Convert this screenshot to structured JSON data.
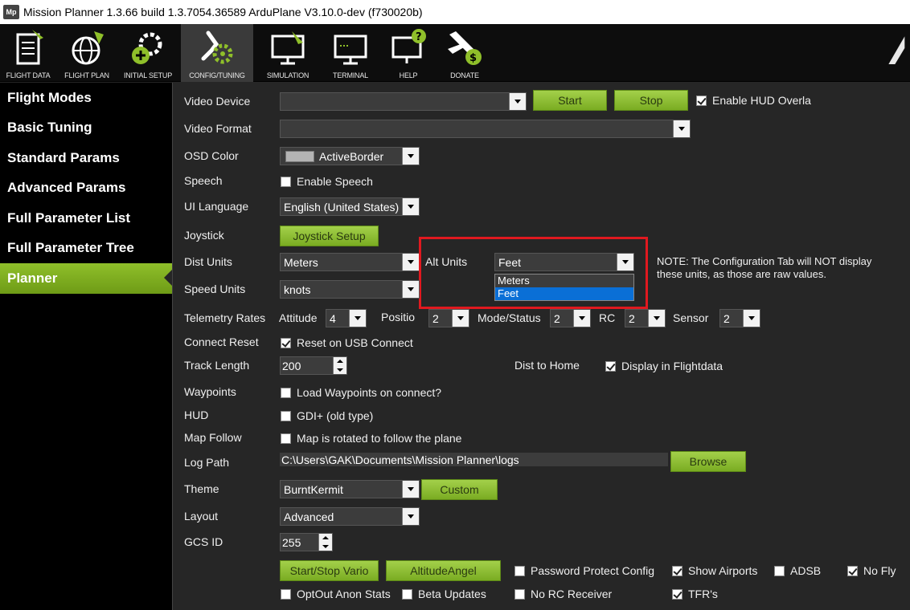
{
  "window": {
    "title": "Mission Planner 1.3.66 build 1.3.7054.36589 ArduPlane V3.10.0-dev (f730020b)",
    "icon_text": "Mp"
  },
  "toolbar": {
    "buttons": [
      {
        "label": "FLIGHT DATA",
        "icon": "flight-data-icon"
      },
      {
        "label": "FLIGHT PLAN",
        "icon": "flight-plan-icon"
      },
      {
        "label": "INITIAL SETUP",
        "icon": "initial-setup-icon"
      },
      {
        "label": "CONFIG/TUNING",
        "icon": "config-tuning-icon"
      },
      {
        "label": "SIMULATION",
        "icon": "simulation-icon"
      },
      {
        "label": "TERMINAL",
        "icon": "terminal-icon"
      },
      {
        "label": "HELP",
        "icon": "help-icon"
      },
      {
        "label": "DONATE",
        "icon": "donate-icon"
      }
    ],
    "active": "CONFIG/TUNING"
  },
  "sidebar": {
    "items": [
      {
        "label": "Flight Modes"
      },
      {
        "label": "Basic Tuning"
      },
      {
        "label": "Standard Params"
      },
      {
        "label": "Advanced Params"
      },
      {
        "label": "Full Parameter List"
      },
      {
        "label": "Full Parameter Tree"
      },
      {
        "label": "Planner"
      }
    ],
    "active": "Planner"
  },
  "planner": {
    "video_device": {
      "label": "Video Device",
      "value": "",
      "start": "Start",
      "stop": "Stop",
      "hud_overlay": "Enable HUD Overla",
      "hud_checked": true
    },
    "video_format": {
      "label": "Video Format",
      "value": ""
    },
    "osd_color": {
      "label": "OSD Color",
      "value": "ActiveBorder"
    },
    "speech": {
      "label": "Speech",
      "checkbox": "Enable Speech",
      "checked": false
    },
    "ui_language": {
      "label": "UI Language",
      "value": "English (United States)"
    },
    "joystick": {
      "label": "Joystick",
      "button": "Joystick Setup"
    },
    "dist_units": {
      "label": "Dist Units",
      "value": "Meters"
    },
    "alt_units": {
      "label": "Alt Units",
      "value": "Feet",
      "options": [
        "Meters",
        "Feet"
      ],
      "selected": "Feet"
    },
    "note": "NOTE: The Configuration Tab will NOT display these units, as those are raw values.",
    "speed_units": {
      "label": "Speed Units",
      "value": "knots"
    },
    "telemetry": {
      "label": "Telemetry Rates",
      "attitude": {
        "label": "Attitude",
        "value": "4"
      },
      "position": {
        "label": "Positio",
        "value": "2"
      },
      "mode_status": {
        "label": "Mode/Status",
        "value": "2"
      },
      "rc": {
        "label": "RC",
        "value": "2"
      },
      "sensor": {
        "label": "Sensor",
        "value": "2"
      }
    },
    "connect_reset": {
      "label": "Connect Reset",
      "checkbox": "Reset on USB Connect",
      "checked": true
    },
    "track_length": {
      "label": "Track Length",
      "value": "200"
    },
    "dist_to_home": {
      "label": "Dist to Home",
      "checkbox": "Display in Flightdata",
      "checked": true
    },
    "waypoints": {
      "label": "Waypoints",
      "checkbox": "Load Waypoints on connect?",
      "checked": false
    },
    "hud": {
      "label": "HUD",
      "checkbox": "GDI+ (old type)",
      "checked": false
    },
    "map_follow": {
      "label": "Map Follow",
      "checkbox": "Map is rotated to follow the plane",
      "checked": false
    },
    "log_path": {
      "label": "Log Path",
      "value": "C:\\Users\\GAK\\Documents\\Mission Planner\\logs",
      "button": "Browse"
    },
    "theme": {
      "label": "Theme",
      "value": "BurntKermit",
      "button": "Custom"
    },
    "layout": {
      "label": "Layout",
      "value": "Advanced"
    },
    "gcs_id": {
      "label": "GCS ID",
      "value": "255"
    },
    "bottom": {
      "start_stop_vario": "Start/Stop Vario",
      "altitude_angel": "AltitudeAngel",
      "password_protect": {
        "label": "Password Protect Config",
        "checked": false
      },
      "show_airports": {
        "label": "Show Airports",
        "checked": true
      },
      "adsb": {
        "label": "ADSB",
        "checked": false
      },
      "no_fly": {
        "label": "No Fly",
        "checked": true
      },
      "optout": {
        "label": "OptOut Anon Stats",
        "checked": false
      },
      "beta": {
        "label": "Beta Updates",
        "checked": false
      },
      "no_rc": {
        "label": "No RC Receiver",
        "checked": false
      },
      "tfrs": {
        "label": "TFR's",
        "checked": true
      }
    }
  },
  "colors": {
    "accent_green": "#8fbf2a",
    "highlight_red": "#e0191f",
    "selection_blue": "#0a6fd6"
  }
}
